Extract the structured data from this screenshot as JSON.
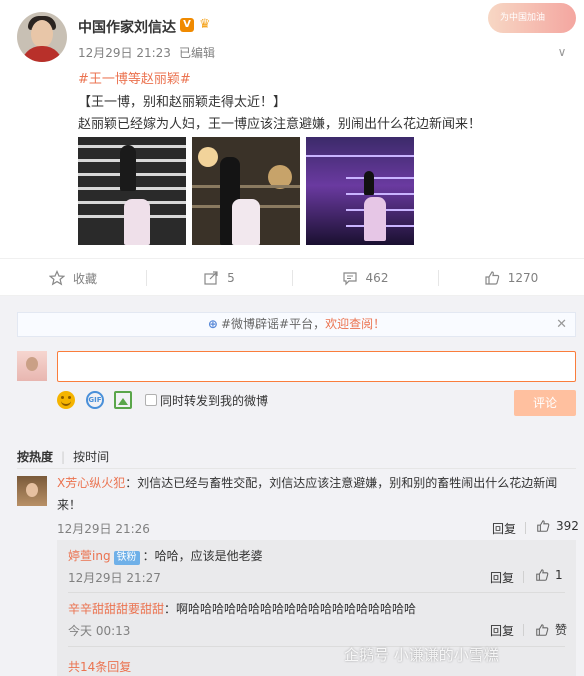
{
  "post": {
    "username": "中国作家刘信达",
    "verified_badge": "V",
    "timestamp": "12月29日 21:23",
    "edited": "已编辑",
    "topic": "#王一博等赵丽颖#",
    "line1": "【王一博，别和赵丽颖走得太近！】",
    "line2": "赵丽颖已经嫁为人妇，王一博应该注意避嫌，别闹出什么花边新闻来！",
    "promo_banner": "为中国加油",
    "image_count": 3
  },
  "actions": {
    "favorite": "收藏",
    "repost_count": "5",
    "comment_count": "462",
    "like_count": "1270"
  },
  "comment_panel": {
    "notice_prefix": "#微博辟谣#平台，",
    "notice_link": "欢迎查阅！",
    "input_value": "",
    "repost_checkbox_label": "同时转发到我的微博",
    "submit_label": "评论",
    "sort_hot": "按热度",
    "sort_time": "按时间"
  },
  "comments": [
    {
      "user": "X芳心纵火犯",
      "text": "：刘信达已经与畜牲交配，刘信达应该注意避嫌，别和别的畜牲闹出什么花边新闻来！",
      "time": "12月29日 21:26",
      "reply_label": "回复",
      "likes": "392",
      "replies": [
        {
          "user": "婷萱ing",
          "badge": "铁粉",
          "text": "：哈哈，应该是他老婆",
          "time": "12月29日 21:27",
          "reply_label": "回复",
          "likes": "1"
        },
        {
          "user": "辛辛甜甜甜要甜甜",
          "text": "：啊哈哈哈哈哈哈哈哈哈哈哈哈哈哈哈哈哈哈哈",
          "time": "今天 00:13",
          "reply_label": "回复",
          "likes": "赞"
        }
      ],
      "more_replies": "共14条回复"
    }
  ],
  "watermark": "企鹅号 小谦谦的小雪糕",
  "colors": {
    "accent": "#eb7350",
    "submit_disabled": "#ffc09f",
    "link_blue": "#5a8ad8"
  },
  "icons": [
    "star-icon",
    "repost-icon",
    "comment-icon",
    "thumb-up-icon",
    "close-icon",
    "emoji-icon",
    "gif-icon",
    "image-icon",
    "chevron-down-icon",
    "crown-icon"
  ]
}
